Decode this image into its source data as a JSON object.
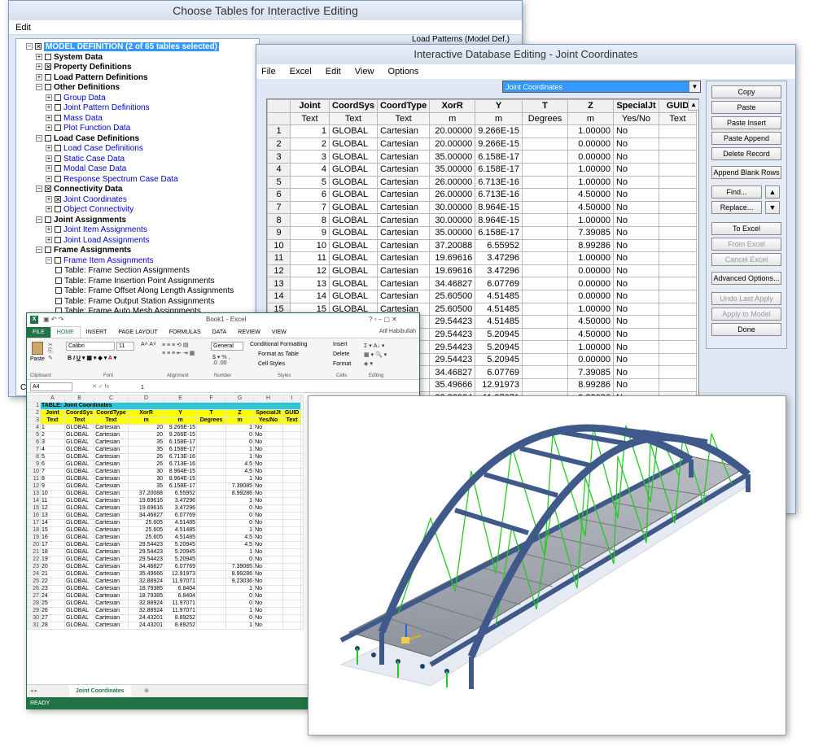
{
  "choose": {
    "title": "Choose Tables for Interactive Editing",
    "menu_edit": "Edit",
    "load_patterns_label": "Load Patterns (Model Def.)",
    "footer_fragment": "Cli",
    "tree": [
      {
        "pm": "−",
        "cb": "☒",
        "text": "MODEL DEFINITION  (2 of 65 tables selected)",
        "style": "sel",
        "indent": 0
      },
      {
        "pm": "+",
        "cb": "",
        "text": "System Data",
        "style": "bold",
        "indent": 1
      },
      {
        "pm": "+",
        "cb": "☒",
        "text": "Property Definitions",
        "style": "bold",
        "indent": 1
      },
      {
        "pm": "+",
        "cb": "",
        "text": "Load Pattern Definitions",
        "style": "bold",
        "indent": 1
      },
      {
        "pm": "−",
        "cb": "",
        "text": "Other Definitions",
        "style": "bold",
        "indent": 1
      },
      {
        "pm": "+",
        "cb": "",
        "text": "Group Data",
        "style": "blue",
        "indent": 2
      },
      {
        "pm": "+",
        "cb": "",
        "text": "Joint Pattern Definitions",
        "style": "blue",
        "indent": 2
      },
      {
        "pm": "+",
        "cb": "",
        "text": "Mass Data",
        "style": "blue",
        "indent": 2
      },
      {
        "pm": "+",
        "cb": "",
        "text": "Plot Function Data",
        "style": "blue",
        "indent": 2
      },
      {
        "pm": "−",
        "cb": "",
        "text": "Load Case Definitions",
        "style": "bold",
        "indent": 1
      },
      {
        "pm": "+",
        "cb": "",
        "text": "Load Case Definitions",
        "style": "blue",
        "indent": 2
      },
      {
        "pm": "+",
        "cb": "",
        "text": "Static Case Data",
        "style": "blue",
        "indent": 2
      },
      {
        "pm": "+",
        "cb": "",
        "text": "Modal Case Data",
        "style": "blue",
        "indent": 2
      },
      {
        "pm": "+",
        "cb": "",
        "text": "Response Spectrum Case Data",
        "style": "blue",
        "indent": 2
      },
      {
        "pm": "−",
        "cb": "☒",
        "text": "Connectivity Data",
        "style": "bold",
        "indent": 1
      },
      {
        "pm": "+",
        "cb": "☒",
        "text": "Joint Coordinates",
        "style": "blue",
        "indent": 2
      },
      {
        "pm": "+",
        "cb": "",
        "text": "Object Connectivity",
        "style": "blue",
        "indent": 2
      },
      {
        "pm": "−",
        "cb": "",
        "text": "Joint Assignments",
        "style": "bold",
        "indent": 1
      },
      {
        "pm": "+",
        "cb": "",
        "text": "Joint Item Assignments",
        "style": "blue",
        "indent": 2
      },
      {
        "pm": "+",
        "cb": "",
        "text": "Joint Load Assignments",
        "style": "blue",
        "indent": 2
      },
      {
        "pm": "−",
        "cb": "",
        "text": "Frame Assignments",
        "style": "bold",
        "indent": 1
      },
      {
        "pm": "−",
        "cb": "",
        "text": "Frame Item Assignments",
        "style": "blue",
        "indent": 2
      },
      {
        "pm": "",
        "cb": "",
        "text": "Table:  Frame Section Assignments",
        "style": "",
        "indent": 3
      },
      {
        "pm": "",
        "cb": "",
        "text": "Table:  Frame Insertion Point Assignments",
        "style": "",
        "indent": 3
      },
      {
        "pm": "",
        "cb": "",
        "text": "Table:  Frame Offset Along Length Assignments",
        "style": "",
        "indent": 3
      },
      {
        "pm": "",
        "cb": "",
        "text": "Table:  Frame Output Station Assignments",
        "style": "",
        "indent": 3
      },
      {
        "pm": "",
        "cb": "",
        "text": "Table:  Frame Auto Mesh Assignments",
        "style": "",
        "indent": 3
      }
    ]
  },
  "db": {
    "title": "Interactive Database Editing - Joint Coordinates",
    "menu": [
      "File",
      "Excel",
      "Edit",
      "View",
      "Options"
    ],
    "selected_table": "Joint Coordinates",
    "columns": [
      "Joint",
      "CoordSys",
      "CoordType",
      "XorR",
      "Y",
      "T",
      "Z",
      "SpecialJt",
      "GUID"
    ],
    "units": [
      "Text",
      "Text",
      "Text",
      "m",
      "m",
      "Degrees",
      "m",
      "Yes/No",
      "Text"
    ],
    "rows": [
      [
        "1",
        "1",
        "GLOBAL",
        "Cartesian",
        "20.00000",
        "9.266E-15",
        "",
        "1.00000",
        "No",
        ""
      ],
      [
        "2",
        "2",
        "GLOBAL",
        "Cartesian",
        "20.00000",
        "9.266E-15",
        "",
        "0.00000",
        "No",
        ""
      ],
      [
        "3",
        "3",
        "GLOBAL",
        "Cartesian",
        "35.00000",
        "6.158E-17",
        "",
        "0.00000",
        "No",
        ""
      ],
      [
        "4",
        "4",
        "GLOBAL",
        "Cartesian",
        "35.00000",
        "6.158E-17",
        "",
        "1.00000",
        "No",
        ""
      ],
      [
        "5",
        "5",
        "GLOBAL",
        "Cartesian",
        "26.00000",
        "6.713E-16",
        "",
        "1.00000",
        "No",
        ""
      ],
      [
        "6",
        "6",
        "GLOBAL",
        "Cartesian",
        "26.00000",
        "6.713E-16",
        "",
        "4.50000",
        "No",
        ""
      ],
      [
        "7",
        "7",
        "GLOBAL",
        "Cartesian",
        "30.00000",
        "8.964E-15",
        "",
        "4.50000",
        "No",
        ""
      ],
      [
        "8",
        "8",
        "GLOBAL",
        "Cartesian",
        "30.00000",
        "8.964E-15",
        "",
        "1.00000",
        "No",
        ""
      ],
      [
        "9",
        "9",
        "GLOBAL",
        "Cartesian",
        "35.00000",
        "6.158E-17",
        "",
        "7.39085",
        "No",
        ""
      ],
      [
        "10",
        "10",
        "GLOBAL",
        "Cartesian",
        "37.20088",
        "6.55952",
        "",
        "8.99286",
        "No",
        ""
      ],
      [
        "11",
        "11",
        "GLOBAL",
        "Cartesian",
        "19.69616",
        "3.47296",
        "",
        "1.00000",
        "No",
        ""
      ],
      [
        "12",
        "12",
        "GLOBAL",
        "Cartesian",
        "19.69616",
        "3.47296",
        "",
        "0.00000",
        "No",
        ""
      ],
      [
        "13",
        "13",
        "GLOBAL",
        "Cartesian",
        "34.46827",
        "6.07769",
        "",
        "0.00000",
        "No",
        ""
      ],
      [
        "14",
        "14",
        "GLOBAL",
        "Cartesian",
        "25.60500",
        "4.51485",
        "",
        "0.00000",
        "No",
        ""
      ],
      [
        "15",
        "15",
        "GLOBAL",
        "Cartesian",
        "25.60500",
        "4.51485",
        "",
        "1.00000",
        "No",
        ""
      ],
      [
        "",
        "",
        "",
        "",
        "29.54423",
        "4.51485",
        "",
        "4.50000",
        "No",
        ""
      ],
      [
        "",
        "",
        "",
        "",
        "29.54423",
        "5.20945",
        "",
        "4.50000",
        "No",
        ""
      ],
      [
        "",
        "",
        "",
        "",
        "29.54423",
        "5.20945",
        "",
        "1.00000",
        "No",
        ""
      ],
      [
        "",
        "",
        "",
        "",
        "29.54423",
        "5.20945",
        "",
        "0.00000",
        "No",
        ""
      ],
      [
        "",
        "",
        "",
        "",
        "34.46827",
        "6.07769",
        "",
        "7.39085",
        "No",
        ""
      ],
      [
        "",
        "",
        "",
        "",
        "35.49666",
        "12.91973",
        "",
        "8.99286",
        "No",
        ""
      ],
      [
        "",
        "",
        "",
        "",
        "32.88924",
        "11.97071",
        "",
        "9.23036",
        "No",
        ""
      ]
    ],
    "buttons": {
      "copy": "Copy",
      "paste": "Paste",
      "paste_insert": "Paste Insert",
      "paste_append": "Paste Append",
      "delete_record": "Delete Record",
      "append_blank": "Append Blank Rows",
      "find": "Find...",
      "replace": "Replace...",
      "to_excel": "To Excel",
      "from_excel": "From Excel",
      "cancel_excel": "Cancel Excel",
      "advanced": "Advanced Options...",
      "undo_last": "Undo Last Apply",
      "apply_model": "Apply to Model",
      "done": "Done"
    }
  },
  "excel": {
    "title": "Book1 - Excel",
    "user": "Atif Habibullah",
    "tabs": [
      "FILE",
      "HOME",
      "INSERT",
      "PAGE LAYOUT",
      "FORMULAS",
      "DATA",
      "REVIEW",
      "VIEW"
    ],
    "font_name": "Calibri",
    "font_size": "11",
    "number_format": "General",
    "ribbon_labels": {
      "paste": "Paste",
      "clipboard": "Clipboard",
      "font": "Font",
      "alignment": "Alignment",
      "number": "Number",
      "cond": "Conditional Formatting",
      "fmt_table": "Format as Table",
      "cell_styles": "Cell Styles",
      "styles": "Styles",
      "insert": "Insert",
      "delete": "Delete",
      "format": "Format",
      "cells": "Cells",
      "editing": "Editing"
    },
    "name_box": "A4",
    "formula_value": "1",
    "col_headers": [
      "A",
      "B",
      "C",
      "D",
      "E",
      "F",
      "G",
      "H",
      "I"
    ],
    "table_title": "TABLE:  Joint Coordinates",
    "header": [
      "Joint",
      "CoordSys",
      "CoordType",
      "XorR",
      "Y",
      "T",
      "Z",
      "SpecialJt",
      "GUID"
    ],
    "units": [
      "Text",
      "Text",
      "Text",
      "m",
      "m",
      "Degrees",
      "m",
      "Yes/No",
      "Text"
    ],
    "rows": [
      [
        "1",
        "GLOBAL",
        "Cartesian",
        "20",
        "9.266E-15",
        "",
        "1",
        "No",
        ""
      ],
      [
        "2",
        "GLOBAL",
        "Cartesian",
        "20",
        "9.266E-15",
        "",
        "0",
        "No",
        ""
      ],
      [
        "3",
        "GLOBAL",
        "Cartesian",
        "35",
        "6.158E-17",
        "",
        "0",
        "No",
        ""
      ],
      [
        "4",
        "GLOBAL",
        "Cartesian",
        "35",
        "6.158E-17",
        "",
        "1",
        "No",
        ""
      ],
      [
        "5",
        "GLOBAL",
        "Cartesian",
        "26",
        "6.713E-16",
        "",
        "1",
        "No",
        ""
      ],
      [
        "6",
        "GLOBAL",
        "Cartesian",
        "26",
        "6.713E-16",
        "",
        "4.5",
        "No",
        ""
      ],
      [
        "7",
        "GLOBAL",
        "Cartesian",
        "30",
        "8.964E-15",
        "",
        "4.5",
        "No",
        ""
      ],
      [
        "8",
        "GLOBAL",
        "Cartesian",
        "30",
        "8.964E-15",
        "",
        "1",
        "No",
        ""
      ],
      [
        "9",
        "GLOBAL",
        "Cartesian",
        "35",
        "6.158E-17",
        "",
        "7.39085",
        "No",
        ""
      ],
      [
        "10",
        "GLOBAL",
        "Cartesian",
        "37.20088",
        "6.55952",
        "",
        "8.99286",
        "No",
        ""
      ],
      [
        "11",
        "GLOBAL",
        "Cartesian",
        "19.69616",
        "3.47296",
        "",
        "1",
        "No",
        ""
      ],
      [
        "12",
        "GLOBAL",
        "Cartesian",
        "19.69616",
        "3.47296",
        "",
        "0",
        "No",
        ""
      ],
      [
        "13",
        "GLOBAL",
        "Cartesian",
        "34.46827",
        "6.07769",
        "",
        "0",
        "No",
        ""
      ],
      [
        "14",
        "GLOBAL",
        "Cartesian",
        "25.605",
        "4.51485",
        "",
        "0",
        "No",
        ""
      ],
      [
        "15",
        "GLOBAL",
        "Cartesian",
        "25.605",
        "4.51485",
        "",
        "1",
        "No",
        ""
      ],
      [
        "16",
        "GLOBAL",
        "Cartesian",
        "25.605",
        "4.51485",
        "",
        "4.5",
        "No",
        ""
      ],
      [
        "17",
        "GLOBAL",
        "Cartesian",
        "29.54423",
        "5.20945",
        "",
        "4.5",
        "No",
        ""
      ],
      [
        "18",
        "GLOBAL",
        "Cartesian",
        "29.54423",
        "5.20945",
        "",
        "1",
        "No",
        ""
      ],
      [
        "19",
        "GLOBAL",
        "Cartesian",
        "29.54423",
        "5.20945",
        "",
        "0",
        "No",
        ""
      ],
      [
        "20",
        "GLOBAL",
        "Cartesian",
        "34.46827",
        "6.07769",
        "",
        "7.39085",
        "No",
        ""
      ],
      [
        "21",
        "GLOBAL",
        "Cartesian",
        "35.49666",
        "12.91973",
        "",
        "8.99286",
        "No",
        ""
      ],
      [
        "22",
        "GLOBAL",
        "Cartesian",
        "32.88924",
        "11.97071",
        "",
        "9.23036",
        "No",
        ""
      ],
      [
        "23",
        "GLOBAL",
        "Cartesian",
        "18.79385",
        "6.8404",
        "",
        "1",
        "No",
        ""
      ],
      [
        "24",
        "GLOBAL",
        "Cartesian",
        "18.79385",
        "6.8404",
        "",
        "0",
        "No",
        ""
      ],
      [
        "25",
        "GLOBAL",
        "Cartesian",
        "32.88924",
        "11.97071",
        "",
        "0",
        "No",
        ""
      ],
      [
        "26",
        "GLOBAL",
        "Cartesian",
        "32.88924",
        "11.97071",
        "",
        "1",
        "No",
        ""
      ],
      [
        "27",
        "GLOBAL",
        "Cartesian",
        "24.43201",
        "8.89252",
        "",
        "0",
        "No",
        ""
      ],
      [
        "28",
        "GLOBAL",
        "Cartesian",
        "24.43201",
        "8.89252",
        "",
        "1",
        "No",
        ""
      ]
    ],
    "sheet_tab": "Joint Coordinates",
    "status": "READY"
  },
  "colors": {
    "excel_green": "#217346",
    "bridge_steel": "#3f5a8a",
    "brace_green": "#22cc22",
    "select_blue": "#3399ff"
  }
}
